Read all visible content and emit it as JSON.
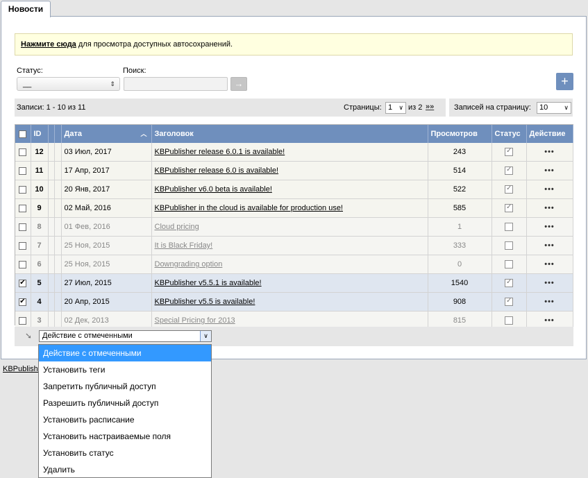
{
  "tab": {
    "label": "Новости"
  },
  "notice": {
    "link": "Нажмите сюда",
    "text": " для просмотра доступных автосохранений."
  },
  "filters": {
    "status_label": "Статус:",
    "status_value": "__",
    "search_label": "Поиск:",
    "search_value": "",
    "go_label": "→",
    "add_label": "+"
  },
  "pager": {
    "records": "Записи: 1 - 10 из 11",
    "pages_label": "Страницы:",
    "current_page": "1",
    "of_label": "из 2",
    "next_label": "»»",
    "per_page_label": "Записей на страницу:",
    "per_page_value": "10"
  },
  "table": {
    "columns": [
      "",
      "ID",
      "",
      "",
      "Дата",
      "Заголовок",
      "Просмотров",
      "Статус",
      "Действие"
    ],
    "sort_indicator": "^",
    "rows": [
      {
        "id": "12",
        "date": "03 Июл, 2017",
        "title": "KBPublisher release 6.0.1 is available!",
        "views": "243",
        "published": true,
        "checked": false
      },
      {
        "id": "11",
        "date": "17 Апр, 2017",
        "title": "KBPublisher release 6.0 is available!",
        "views": "514",
        "published": true,
        "checked": false
      },
      {
        "id": "10",
        "date": "20 Янв, 2017",
        "title": "KBPublisher v6.0 beta is available!",
        "views": "522",
        "published": true,
        "checked": false
      },
      {
        "id": "9",
        "date": "02 Май, 2016",
        "title": "KBPublisher in the cloud is available for production use!",
        "views": "585",
        "published": true,
        "checked": false
      },
      {
        "id": "8",
        "date": "01 Фев, 2016",
        "title": "Cloud pricing",
        "views": "1",
        "published": false,
        "checked": false
      },
      {
        "id": "7",
        "date": "25 Ноя, 2015",
        "title": "It is Black Friday!",
        "views": "333",
        "published": false,
        "checked": false
      },
      {
        "id": "6",
        "date": "25 Ноя, 2015",
        "title": "Downgrading option",
        "views": "0",
        "published": false,
        "checked": false
      },
      {
        "id": "5",
        "date": "27 Июл, 2015",
        "title": "KBPublisher v5.5.1 is available!",
        "views": "1540",
        "published": true,
        "checked": true
      },
      {
        "id": "4",
        "date": "20 Апр, 2015",
        "title": "KBPublisher v5.5 is available!",
        "views": "908",
        "published": true,
        "checked": true
      },
      {
        "id": "3",
        "date": "02 Дек, 2013",
        "title": "Special Pricing for 2013",
        "views": "815",
        "published": false,
        "checked": false
      }
    ],
    "action_label": "•••"
  },
  "bulk": {
    "select_value": "Действие с отмеченными",
    "options": [
      "Действие с отмеченными",
      "Установить теги",
      "Запретить публичный доступ",
      "Разрешить публичный доступ",
      "Установить расписание",
      "Установить настраиваемые поля",
      "Установить статус",
      "Удалить"
    ]
  },
  "footer": {
    "link": "KBPublishe"
  },
  "colors": {
    "header_blue": "#6f8fbd",
    "highlight": "#3399ff",
    "notice_bg": "#ffffe0"
  }
}
